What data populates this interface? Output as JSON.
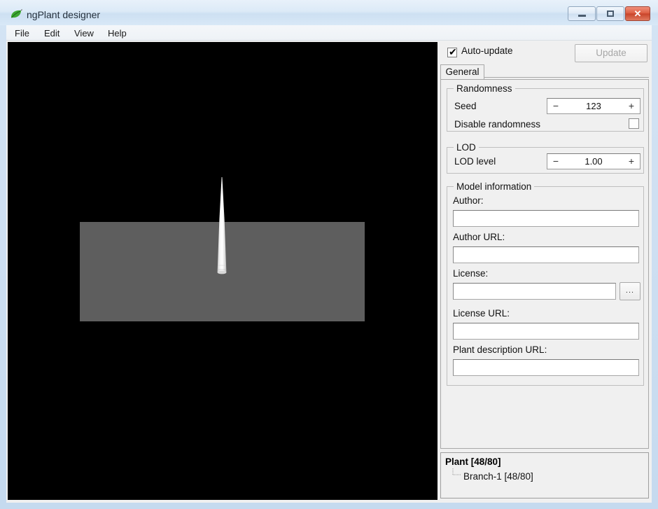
{
  "window": {
    "title": "ngPlant designer",
    "icon": "leaf-icon",
    "controls": {
      "minimize": "minimize-icon",
      "maximize": "maximize-icon",
      "close": "✕"
    }
  },
  "menubar": {
    "items": [
      {
        "label": "File"
      },
      {
        "label": "Edit"
      },
      {
        "label": "View"
      },
      {
        "label": "Help"
      }
    ]
  },
  "viewport": {
    "name": "3d-preview",
    "background_color": "#000000",
    "ground_color": "#5e5e5e",
    "stem_color": "#f2f2f2"
  },
  "panel": {
    "auto_update": {
      "label": "Auto-update",
      "checked": true,
      "check_glyph": "✔"
    },
    "update_button": {
      "label": "Update",
      "enabled": false
    },
    "tabs": [
      {
        "label": "General",
        "selected": true
      }
    ],
    "randomness": {
      "title": "Randomness",
      "seed": {
        "label": "Seed",
        "value": "123",
        "minus": "−",
        "plus": "+"
      },
      "disable_randomness": {
        "label": "Disable randomness",
        "checked": false
      }
    },
    "lod": {
      "title": "LOD",
      "level": {
        "label": "LOD level",
        "value": "1.00",
        "minus": "−",
        "plus": "+"
      }
    },
    "model_information": {
      "title": "Model information",
      "fields": [
        {
          "label": "Author:",
          "value": "",
          "placeholder": ""
        },
        {
          "label": "Author URL:",
          "value": "",
          "placeholder": ""
        },
        {
          "label": "License:",
          "value": "",
          "placeholder": "",
          "browse_label": "..."
        },
        {
          "label": "License URL:",
          "value": "",
          "placeholder": ""
        },
        {
          "label": "Plant description URL:",
          "value": "",
          "placeholder": ""
        }
      ]
    },
    "tree": {
      "root": "Plant [48/80]",
      "child": "Branch-1 [48/80]"
    }
  }
}
